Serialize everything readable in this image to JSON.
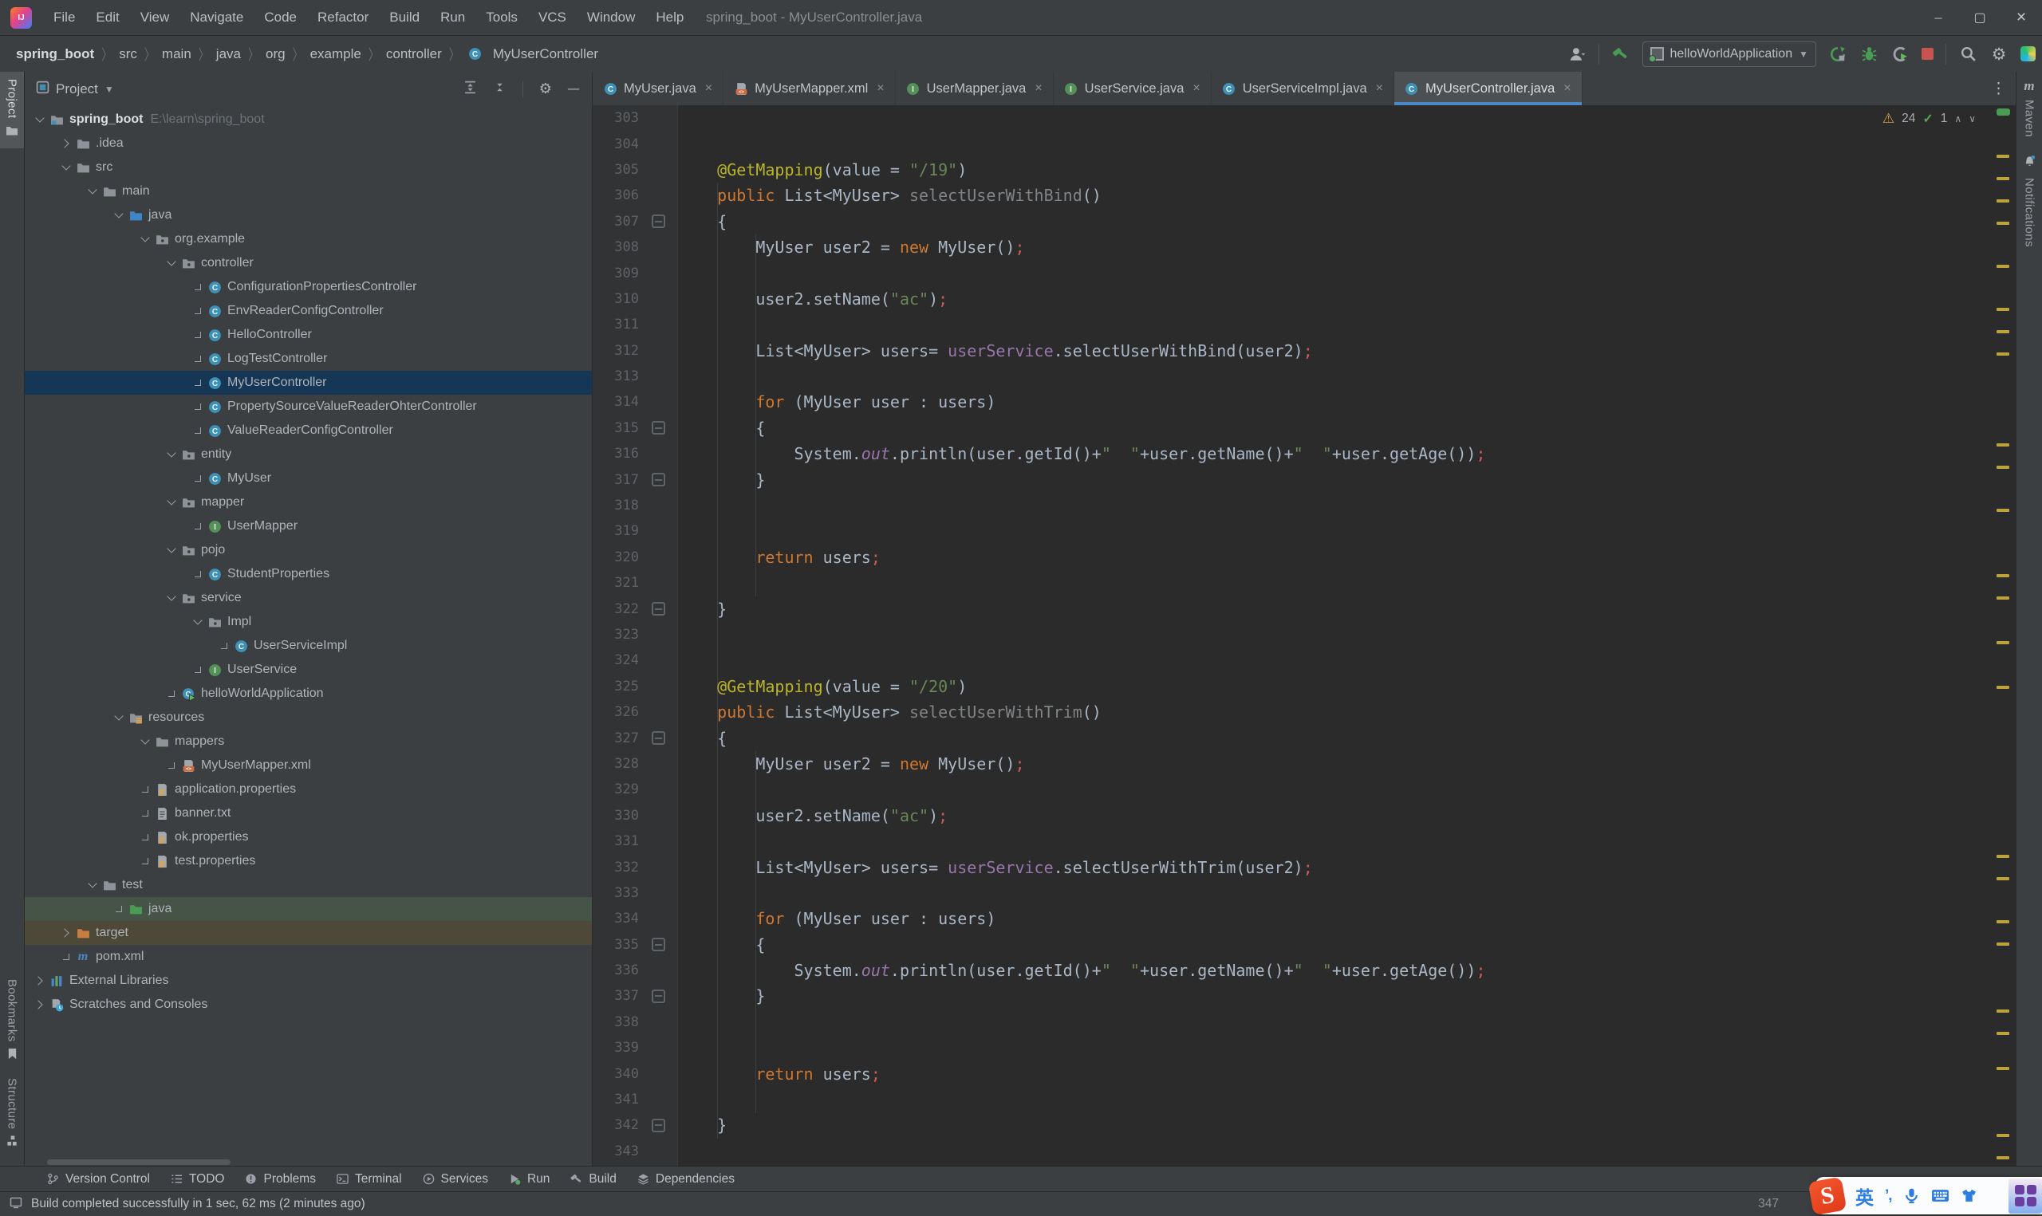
{
  "window": {
    "title": "spring_boot - MyUserController.java",
    "menu": [
      "File",
      "Edit",
      "View",
      "Navigate",
      "Code",
      "Refactor",
      "Build",
      "Run",
      "Tools",
      "VCS",
      "Window",
      "Help"
    ],
    "controls": [
      "minimize",
      "maximize",
      "close"
    ]
  },
  "toolbar": {
    "breadcrumbs": [
      "spring_boot",
      "src",
      "main",
      "java",
      "org",
      "example",
      "controller",
      "MyUserController"
    ],
    "run_config": "helloWorldApplication",
    "right_icons": [
      "user-icon",
      "hammer-icon",
      "rerun-icon",
      "debug-icon",
      "profiler-icon",
      "stop-icon",
      "search-icon",
      "gear-icon",
      "plugin-icon"
    ]
  },
  "left_stripe": {
    "top": [
      {
        "label": "Project",
        "icon": "folder-icon",
        "active": true
      }
    ],
    "bottom": [
      {
        "label": "Bookmarks",
        "icon": "bookmark-icon"
      },
      {
        "label": "Structure",
        "icon": "structure-icon"
      }
    ]
  },
  "right_stripe": [
    {
      "label": "Maven",
      "icon": "maven-icon"
    },
    {
      "label": "Notifications",
      "icon": "bell-icon"
    }
  ],
  "project_panel": {
    "header": {
      "title": "Project",
      "icons": [
        "expand-all-icon",
        "collapse-all-icon",
        "gear-icon",
        "hide-icon"
      ]
    },
    "tree": [
      {
        "d": 0,
        "ch": "down",
        "ic": "project",
        "t": "spring_boot",
        "bold": true,
        "sfx": "E:\\learn\\spring_boot"
      },
      {
        "d": 1,
        "ch": "right",
        "ic": "folder",
        "t": ".idea"
      },
      {
        "d": 1,
        "ch": "down",
        "ic": "folder",
        "t": "src"
      },
      {
        "d": 2,
        "ch": "down",
        "ic": "folder",
        "t": "main"
      },
      {
        "d": 3,
        "ch": "down",
        "ic": "srcfolder",
        "t": "java"
      },
      {
        "d": 4,
        "ch": "down",
        "ic": "package",
        "t": "org.example"
      },
      {
        "d": 5,
        "ch": "down",
        "ic": "package",
        "t": "controller"
      },
      {
        "d": 6,
        "ic": "class",
        "t": "ConfigurationPropertiesController"
      },
      {
        "d": 6,
        "ic": "class",
        "t": "EnvReaderConfigController"
      },
      {
        "d": 6,
        "ic": "class",
        "t": "HelloController"
      },
      {
        "d": 6,
        "ic": "class",
        "t": "LogTestController"
      },
      {
        "d": 6,
        "ic": "class",
        "t": "MyUserController",
        "sel": "selected"
      },
      {
        "d": 6,
        "ic": "class",
        "t": "PropertySourceValueReaderOhterController"
      },
      {
        "d": 6,
        "ic": "class",
        "t": "ValueReaderConfigController"
      },
      {
        "d": 5,
        "ch": "down",
        "ic": "package",
        "t": "entity"
      },
      {
        "d": 6,
        "ic": "class",
        "t": "MyUser"
      },
      {
        "d": 5,
        "ch": "down",
        "ic": "package",
        "t": "mapper"
      },
      {
        "d": 6,
        "ic": "interface",
        "t": "UserMapper"
      },
      {
        "d": 5,
        "ch": "down",
        "ic": "package",
        "t": "pojo"
      },
      {
        "d": 6,
        "ic": "class",
        "t": "StudentProperties"
      },
      {
        "d": 5,
        "ch": "down",
        "ic": "package",
        "t": "service"
      },
      {
        "d": 6,
        "ch": "down",
        "ic": "package",
        "t": "Impl"
      },
      {
        "d": 7,
        "ic": "class",
        "t": "UserServiceImpl"
      },
      {
        "d": 6,
        "ic": "interface",
        "t": "UserService"
      },
      {
        "d": 5,
        "ic": "classrun",
        "t": "helloWorldApplication"
      },
      {
        "d": 3,
        "ch": "down",
        "ic": "resfolder",
        "t": "resources"
      },
      {
        "d": 4,
        "ch": "down",
        "ic": "folder",
        "t": "mappers"
      },
      {
        "d": 5,
        "ic": "xml",
        "t": "MyUserMapper.xml"
      },
      {
        "d": 4,
        "ic": "props",
        "t": "application.properties"
      },
      {
        "d": 4,
        "ic": "txt",
        "t": "banner.txt"
      },
      {
        "d": 4,
        "ic": "props",
        "t": "ok.properties"
      },
      {
        "d": 4,
        "ic": "props",
        "t": "test.properties"
      },
      {
        "d": 2,
        "ch": "down",
        "ic": "folder",
        "t": "test"
      },
      {
        "d": 3,
        "ic": "testfolder",
        "t": "java",
        "sel": "green"
      },
      {
        "d": 1,
        "ch": "right",
        "ic": "exfolder",
        "t": "target",
        "sel": "excluded"
      },
      {
        "d": 1,
        "ic": "maven",
        "t": "pom.xml"
      },
      {
        "d": 0,
        "ch": "right",
        "ic": "libs",
        "t": "External Libraries"
      },
      {
        "d": 0,
        "ch": "right",
        "ic": "scratch",
        "t": "Scratches and Consoles"
      }
    ]
  },
  "tabs": [
    {
      "icon": "class",
      "label": "MyUser.java"
    },
    {
      "icon": "xml",
      "label": "MyUserMapper.xml"
    },
    {
      "icon": "interface",
      "label": "UserMapper.java"
    },
    {
      "icon": "interface",
      "label": "UserService.java"
    },
    {
      "icon": "class",
      "label": "UserServiceImpl.java"
    },
    {
      "icon": "class",
      "label": "MyUserController.java",
      "active": true
    }
  ],
  "editor": {
    "inspections": {
      "warnings": "24",
      "typos": "1"
    },
    "lines": [
      {
        "n": 303,
        "t": []
      },
      {
        "n": 304,
        "t": []
      },
      {
        "n": 305,
        "t": [
          [
            "pl",
            "    "
          ],
          [
            "ann",
            "@GetMapping"
          ],
          [
            "pl",
            "(value = "
          ],
          [
            "str",
            "\"/19\""
          ],
          [
            "pl",
            ")"
          ]
        ]
      },
      {
        "n": 306,
        "t": [
          [
            "pl",
            "    "
          ],
          [
            "kw",
            "public"
          ],
          [
            "pl",
            " List<MyUser> "
          ],
          [
            "gray",
            "selectUserWithBind"
          ],
          [
            "pl",
            "()"
          ]
        ]
      },
      {
        "n": 307,
        "f": "s",
        "t": [
          [
            "pl",
            "    {"
          ]
        ]
      },
      {
        "n": 308,
        "t": [
          [
            "pl",
            "        MyUser user2 = "
          ],
          [
            "kw",
            "new"
          ],
          [
            "pl",
            " MyUser()"
          ],
          [
            "semi",
            ";"
          ]
        ]
      },
      {
        "n": 309,
        "t": []
      },
      {
        "n": 310,
        "t": [
          [
            "pl",
            "        user2.setName("
          ],
          [
            "str",
            "\"ac\""
          ],
          [
            "pl",
            ")"
          ],
          [
            "semi",
            ";"
          ]
        ]
      },
      {
        "n": 311,
        "t": []
      },
      {
        "n": 312,
        "t": [
          [
            "pl",
            "        List<MyUser> users= "
          ],
          [
            "fld",
            "userService"
          ],
          [
            "pl",
            ".selectUserWithBind(user2)"
          ],
          [
            "semi",
            ";"
          ]
        ]
      },
      {
        "n": 313,
        "t": []
      },
      {
        "n": 314,
        "t": [
          [
            "pl",
            "        "
          ],
          [
            "kw",
            "for"
          ],
          [
            "pl",
            " (MyUser user : users)"
          ]
        ]
      },
      {
        "n": 315,
        "f": "s",
        "t": [
          [
            "pl",
            "        {"
          ]
        ]
      },
      {
        "n": 316,
        "t": [
          [
            "pl",
            "            System."
          ],
          [
            "fldi",
            "out"
          ],
          [
            "pl",
            ".println(user.getId()+"
          ],
          [
            "str",
            "\"  \""
          ],
          [
            "pl",
            "+user.getName()+"
          ],
          [
            "str",
            "\"  \""
          ],
          [
            "pl",
            "+user.getAge())"
          ],
          [
            "semi",
            ";"
          ]
        ]
      },
      {
        "n": 317,
        "f": "e",
        "t": [
          [
            "pl",
            "        }"
          ]
        ]
      },
      {
        "n": 318,
        "t": []
      },
      {
        "n": 319,
        "t": []
      },
      {
        "n": 320,
        "t": [
          [
            "pl",
            "        "
          ],
          [
            "kw",
            "return"
          ],
          [
            "pl",
            " users"
          ],
          [
            "semi",
            ";"
          ]
        ]
      },
      {
        "n": 321,
        "t": []
      },
      {
        "n": 322,
        "f": "e",
        "t": [
          [
            "pl",
            "    }"
          ]
        ]
      },
      {
        "n": 323,
        "t": []
      },
      {
        "n": 324,
        "t": []
      },
      {
        "n": 325,
        "t": [
          [
            "pl",
            "    "
          ],
          [
            "ann",
            "@GetMapping"
          ],
          [
            "pl",
            "(value = "
          ],
          [
            "str",
            "\"/20\""
          ],
          [
            "pl",
            ")"
          ]
        ]
      },
      {
        "n": 326,
        "t": [
          [
            "pl",
            "    "
          ],
          [
            "kw",
            "public"
          ],
          [
            "pl",
            " List<MyUser> "
          ],
          [
            "gray",
            "selectUserWithTrim"
          ],
          [
            "pl",
            "()"
          ]
        ]
      },
      {
        "n": 327,
        "f": "s",
        "t": [
          [
            "pl",
            "    {"
          ]
        ]
      },
      {
        "n": 328,
        "t": [
          [
            "pl",
            "        MyUser user2 = "
          ],
          [
            "kw",
            "new"
          ],
          [
            "pl",
            " MyUser()"
          ],
          [
            "semi",
            ";"
          ]
        ]
      },
      {
        "n": 329,
        "t": []
      },
      {
        "n": 330,
        "t": [
          [
            "pl",
            "        user2.setName("
          ],
          [
            "str",
            "\"ac\""
          ],
          [
            "pl",
            ")"
          ],
          [
            "semi",
            ";"
          ]
        ]
      },
      {
        "n": 331,
        "t": []
      },
      {
        "n": 332,
        "t": [
          [
            "pl",
            "        List<MyUser> users= "
          ],
          [
            "fld",
            "userService"
          ],
          [
            "pl",
            ".selectUserWithTrim(user2)"
          ],
          [
            "semi",
            ";"
          ]
        ]
      },
      {
        "n": 333,
        "t": []
      },
      {
        "n": 334,
        "t": [
          [
            "pl",
            "        "
          ],
          [
            "kw",
            "for"
          ],
          [
            "pl",
            " (MyUser user : users)"
          ]
        ]
      },
      {
        "n": 335,
        "f": "s",
        "t": [
          [
            "pl",
            "        {"
          ]
        ]
      },
      {
        "n": 336,
        "t": [
          [
            "pl",
            "            System."
          ],
          [
            "fldi",
            "out"
          ],
          [
            "pl",
            ".println(user.getId()+"
          ],
          [
            "str",
            "\"  \""
          ],
          [
            "pl",
            "+user.getName()+"
          ],
          [
            "str",
            "\"  \""
          ],
          [
            "pl",
            "+user.getAge())"
          ],
          [
            "semi",
            ";"
          ]
        ]
      },
      {
        "n": 337,
        "f": "e",
        "t": [
          [
            "pl",
            "        }"
          ]
        ]
      },
      {
        "n": 338,
        "t": []
      },
      {
        "n": 339,
        "t": []
      },
      {
        "n": 340,
        "t": [
          [
            "pl",
            "        "
          ],
          [
            "kw",
            "return"
          ],
          [
            "pl",
            " users"
          ],
          [
            "semi",
            ";"
          ]
        ]
      },
      {
        "n": 341,
        "t": []
      },
      {
        "n": 342,
        "f": "e",
        "t": [
          [
            "pl",
            "    }"
          ]
        ]
      },
      {
        "n": 343,
        "t": []
      }
    ],
    "scroll_marks": [
      62,
      90,
      118,
      146,
      200,
      254,
      282,
      310,
      424,
      452,
      506,
      588,
      616,
      672,
      728,
      940,
      968,
      1022,
      1050,
      1134,
      1162,
      1206,
      1290,
      1318
    ]
  },
  "bottom_bar": [
    {
      "icon": "branch",
      "label": "Version Control"
    },
    {
      "icon": "todo",
      "label": "TODO"
    },
    {
      "icon": "problems",
      "label": "Problems"
    },
    {
      "icon": "terminal",
      "label": "Terminal"
    },
    {
      "icon": "services",
      "label": "Services"
    },
    {
      "icon": "run",
      "label": "Run"
    },
    {
      "icon": "build",
      "label": "Build"
    },
    {
      "icon": "deps",
      "label": "Dependencies"
    }
  ],
  "status_bar": {
    "message": "Build completed successfully in 1 sec, 62 ms (2 minutes ago)",
    "caret_indicator": "347"
  },
  "ime_bar": {
    "brand": "S",
    "lang_label": "英",
    "punct_label": "’,",
    "icons": [
      "sogou-logo",
      "language-mode-icon",
      "punctuation-icon",
      "microphone-icon",
      "keyboard-icon",
      "skin-icon",
      "apps-grid-icon"
    ]
  },
  "colors": {
    "panel_bg": "#3C3F41",
    "editor_bg": "#2B2B2B",
    "accent_blue": "#4A88C7",
    "selection_bg": "#153655",
    "test_source_green": "#455446",
    "excluded_brown": "#4E4838",
    "warning_yellow": "#D9A343",
    "keyword_orange": "#CC7832",
    "string_green": "#6A8759",
    "annotation_yellow": "#BBB529",
    "field_purple": "#9876AA",
    "semicolon_red": "#CF5B56",
    "run_green": "#499C54",
    "stop_red": "#C75450"
  }
}
